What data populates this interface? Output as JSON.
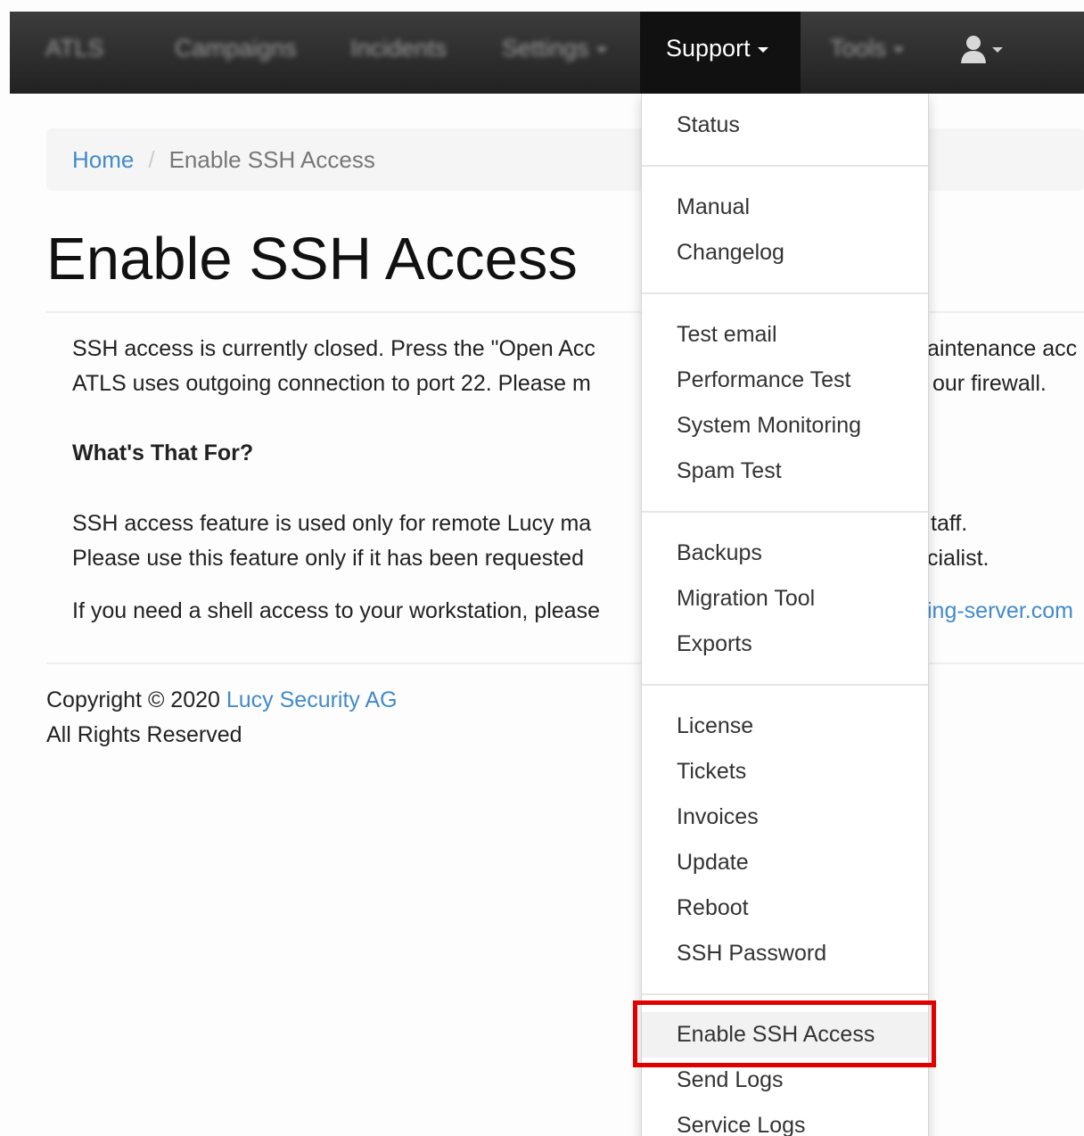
{
  "navbar": {
    "brand": "ATLS",
    "items": [
      "Campaigns",
      "Incidents",
      "Settings"
    ],
    "active_label": "Support",
    "tools_label": "Tools",
    "user_icon": "user-icon"
  },
  "breadcrumb": {
    "home": "Home",
    "separator": "/",
    "current": "Enable SSH Access"
  },
  "page": {
    "title": "Enable SSH Access",
    "intro_line1": "SSH access is currently closed. Press the \"Open Acc",
    "intro_line1_tail": "aintenance acc",
    "intro_line2": "ATLS uses outgoing connection to port 22. Please m",
    "intro_line2_tail": "our firewall.",
    "section_heading": "What's That For?",
    "feature_line1": "SSH access feature is used only for remote Lucy ma",
    "feature_line1_tail": "taff.",
    "feature_line2": "Please use this feature only if it has been requested",
    "feature_line2_tail": "cialist.",
    "shell_line": "If you need a shell access to your workstation, please",
    "shell_line_tail": "ing-server.com"
  },
  "footer": {
    "copyright_prefix": "Copyright © 2020",
    "company_link": "Lucy Security AG",
    "rights": "All Rights Reserved"
  },
  "dropdown": {
    "groups": [
      [
        "Status"
      ],
      [
        "Manual",
        "Changelog"
      ],
      [
        "Test email",
        "Performance Test",
        "System Monitoring",
        "Spam Test"
      ],
      [
        "Backups",
        "Migration Tool",
        "Exports"
      ],
      [
        "License",
        "Tickets",
        "Invoices",
        "Update",
        "Reboot",
        "SSH Password"
      ],
      [
        "Enable SSH Access",
        "Send Logs",
        "Service Logs"
      ]
    ],
    "highlighted": "Enable SSH Access",
    "highlight_color": "#e10000"
  }
}
